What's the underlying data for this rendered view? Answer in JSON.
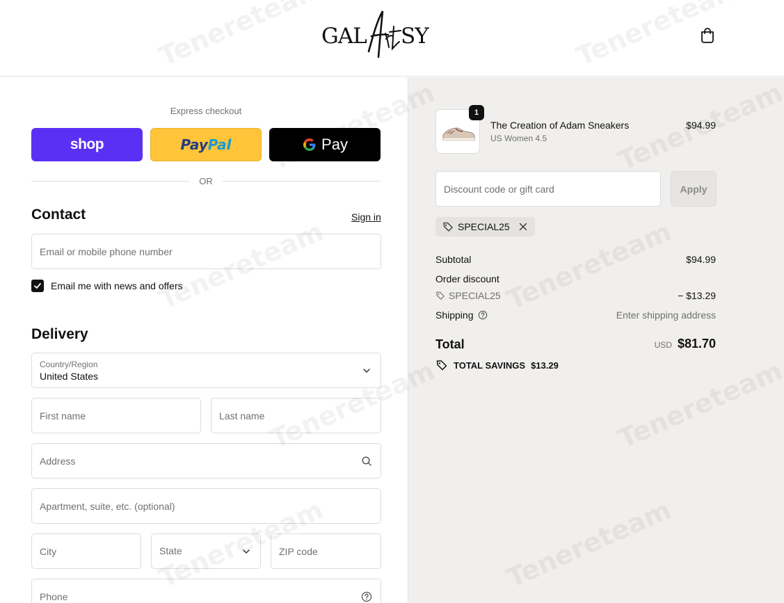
{
  "header": {
    "logo_text": "GALArtSY",
    "cart_icon": "shopping-bag-icon"
  },
  "express": {
    "label": "Express checkout",
    "shop_label": "shop",
    "paypal_part1": "Pay",
    "paypal_part2": "Pal",
    "gpay_label": "Pay",
    "or_label": "OR"
  },
  "contact": {
    "title": "Contact",
    "signin_label": "Sign in",
    "email_placeholder": "Email or mobile phone number",
    "newsletter_label": "Email me with news and offers",
    "newsletter_checked": true
  },
  "delivery": {
    "title": "Delivery",
    "country_label": "Country/Region",
    "country_value": "United States",
    "first_name_placeholder": "First name",
    "last_name_placeholder": "Last name",
    "address_placeholder": "Address",
    "apartment_placeholder": "Apartment, suite, etc. (optional)",
    "city_placeholder": "City",
    "state_placeholder": "State",
    "zip_placeholder": "ZIP code",
    "phone_placeholder": "Phone"
  },
  "summary": {
    "item": {
      "quantity": "1",
      "name": "The Creation of Adam Sneakers",
      "variant": "US Women 4.5",
      "price": "$94.99"
    },
    "discount_placeholder": "Discount code or gift card",
    "apply_label": "Apply",
    "applied_code": "SPECIAL25",
    "subtotal_label": "Subtotal",
    "subtotal_value": "$94.99",
    "order_discount_label": "Order discount",
    "discount_code": "SPECIAL25",
    "discount_value": "− $13.29",
    "shipping_label": "Shipping",
    "shipping_value": "Enter shipping address",
    "total_label": "Total",
    "total_currency": "USD",
    "total_value": "$81.70",
    "savings_label": "TOTAL SAVINGS",
    "savings_value": "$13.29"
  },
  "watermark": "Tenereteam",
  "colors": {
    "shop_purple": "#5a31f4",
    "paypal_yellow": "#ffc439",
    "summary_bg": "#f0efed"
  }
}
